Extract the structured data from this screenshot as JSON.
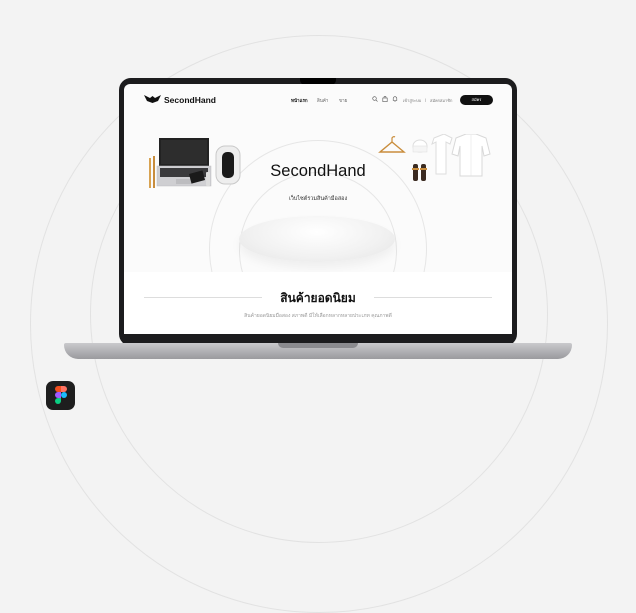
{
  "site": {
    "brand": "SecondHand",
    "nav": {
      "home": "หน้าแรก",
      "products": "สินค้า",
      "sell": "ขาย"
    },
    "header_actions": {
      "login": "เข้าสู่ระบบ",
      "separator": "|",
      "register": "สมัครสมาชิก",
      "signup_button": "สมัคร"
    }
  },
  "hero": {
    "title": "SecondHand",
    "subtitle": "เว็บไซต์รวมสินค้ามือสอง"
  },
  "popular": {
    "title": "สินค้ายอดนิยม",
    "subtitle": "สินค้ายอดนิยมมือสอง สภาพดี มีให้เลือกหลากหลายประเภท คุณภาพดี"
  },
  "colors": {
    "background": "#f3f3f3",
    "laptop_bezel": "#1c1c1e",
    "button": "#111111",
    "figma_red": "#f24e1e",
    "figma_orange": "#ff7262",
    "figma_purple": "#a259ff",
    "figma_blue": "#1abcfe",
    "figma_green": "#0acf83"
  },
  "icons": {
    "brand": "bird-wings-logo-icon",
    "search": "search-icon",
    "cart": "shopping-bag-icon",
    "notification": "bell-icon",
    "figma": "figma-logo-icon"
  }
}
